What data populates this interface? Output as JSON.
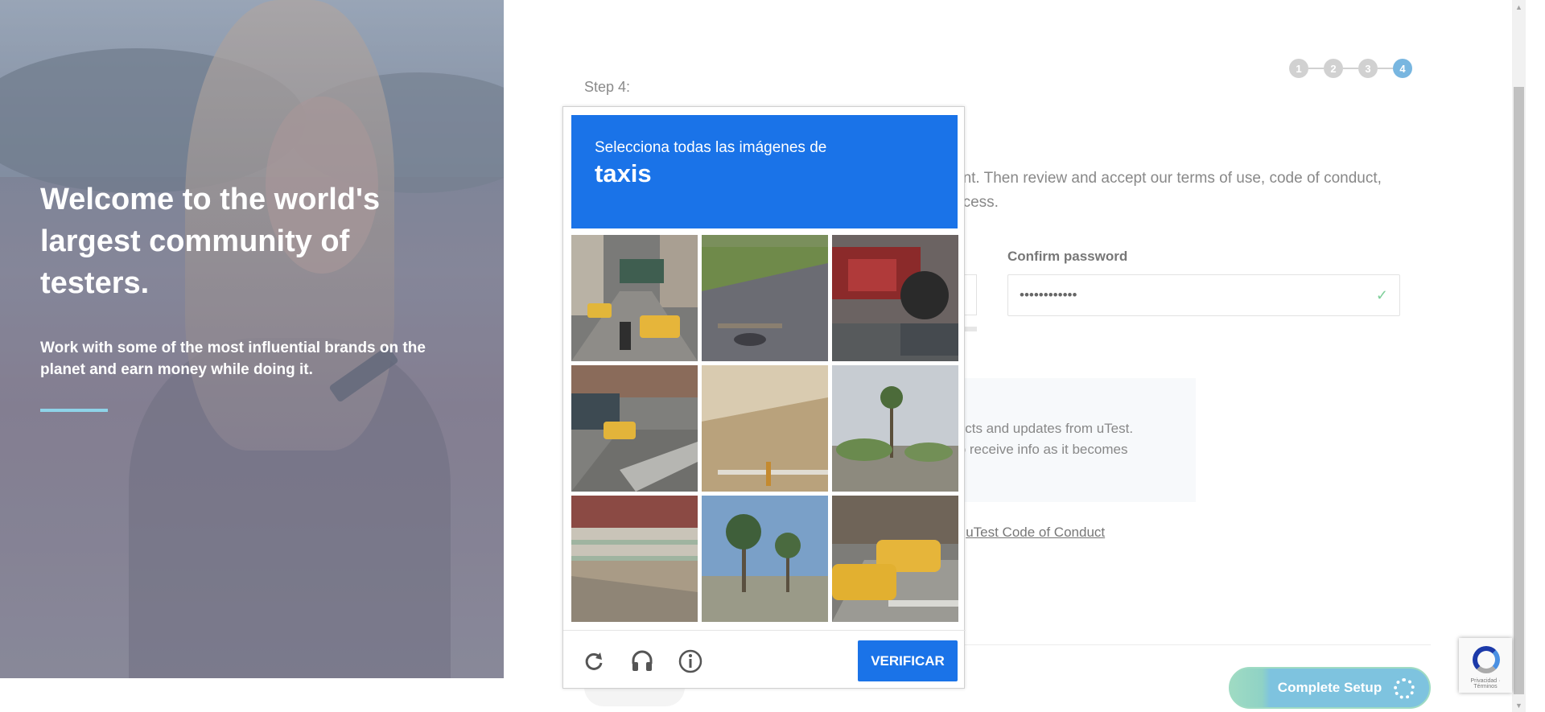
{
  "hero": {
    "headline": "Welcome to the world's largest community of testers.",
    "subtext": "Work with some of the most influential brands on the planet and earn money while doing it."
  },
  "stepper": {
    "steps": [
      "1",
      "2",
      "3",
      "4"
    ],
    "current": "4"
  },
  "form": {
    "step_label": "Step 4:",
    "intro_text": "unt. Then review and accept our terms of use, code of conduct, ocess.",
    "confirm_password": {
      "label": "Confirm password",
      "value": "••••••••••••"
    },
    "info_line1": "jects and updates from uTest.",
    "info_line2": "to receive info as it becomes",
    "coc_prefix": "e ",
    "coc_link": "uTest Code of Conduct",
    "complete_button": "Complete Setup"
  },
  "captcha": {
    "instruction": "Selecciona todas las imágenes de",
    "target": "taxis",
    "verify_label": "VERIFICAR",
    "tiles": [
      "city street with taxis",
      "parking lot pavement",
      "red tractor",
      "street with yellow taxi",
      "sandy dunes",
      "road with palm tree",
      "bridge railing",
      "palm trees by beach",
      "crosswalk with yellow taxis"
    ]
  },
  "recaptcha_badge": {
    "text": "Privacidad · Términos"
  },
  "colors": {
    "captcha_blue": "#1a73e8",
    "step_active": "#78b6e0",
    "complete_button": "#7ec3df"
  }
}
